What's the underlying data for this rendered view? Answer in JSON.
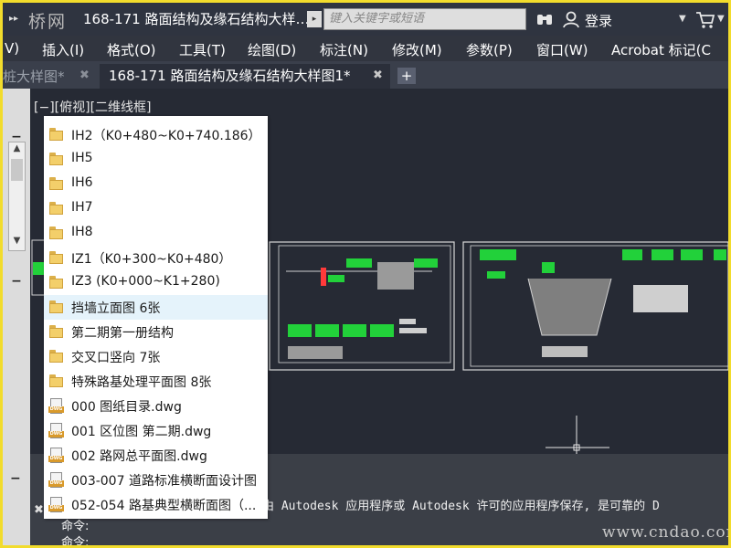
{
  "titlebar": {
    "logo_text": "桥网",
    "document_title": "168-171 路面结构及缘石结构大样…",
    "search_placeholder": "键入关键字或短语",
    "login_label": "登录"
  },
  "menubar": {
    "items": [
      {
        "label": "V)"
      },
      {
        "label": "插入(I)"
      },
      {
        "label": "格式(O)"
      },
      {
        "label": "工具(T)"
      },
      {
        "label": "绘图(D)"
      },
      {
        "label": "标注(N)"
      },
      {
        "label": "修改(M)"
      },
      {
        "label": "参数(P)"
      },
      {
        "label": "窗口(W)"
      },
      {
        "label": "Acrobat 标记(C"
      }
    ]
  },
  "tabs": {
    "tab1_label": "桩大样图*",
    "tab2_label": "168-171 路面结构及缘石结构大样图1*"
  },
  "viewport": {
    "view_label": "[−][俯视][二维线框]"
  },
  "file_list": {
    "items": [
      {
        "label": "IH2（K0+480~K0+740.186）",
        "type": "folder"
      },
      {
        "label": "IH5",
        "type": "folder"
      },
      {
        "label": "IH6",
        "type": "folder"
      },
      {
        "label": "IH7",
        "type": "folder"
      },
      {
        "label": "IH8",
        "type": "folder"
      },
      {
        "label": "IZ1（K0+300~K0+480）",
        "type": "folder"
      },
      {
        "label": "IZ3 (K0+000~K1+280)",
        "type": "folder"
      },
      {
        "label": "挡墙立面图  6张",
        "type": "folder",
        "selected": true
      },
      {
        "label": "第二期第一册结构",
        "type": "folder"
      },
      {
        "label": "交叉口竖向 7张",
        "type": "folder"
      },
      {
        "label": "特殊路基处理平面图 8张",
        "type": "folder"
      },
      {
        "label": "000 图纸目录.dwg",
        "type": "dwg"
      },
      {
        "label": "001 区位图 第二期.dwg",
        "type": "dwg"
      },
      {
        "label": "002 路网总平面图.dwg",
        "type": "dwg"
      },
      {
        "label": "003-007 道路标准横断面设计图",
        "type": "dwg"
      },
      {
        "label": "052-054 路基典型横断面图（...",
        "type": "dwg"
      }
    ],
    "dwg_badge": "DWG"
  },
  "command": {
    "history_text": "由 Autodesk 应用程序或 Autodesk 许可的应用程序保存, 是可靠的 D",
    "prompt1": "命令:",
    "prompt2": "命令:"
  },
  "watermark": "www.cndao.com",
  "colors": {
    "frame": "#f2dc2c",
    "app_bg": "#2b2f3a",
    "selection": "#e5f3fb",
    "cad_green": "#22d13a",
    "cad_red": "#ff3a3a"
  }
}
